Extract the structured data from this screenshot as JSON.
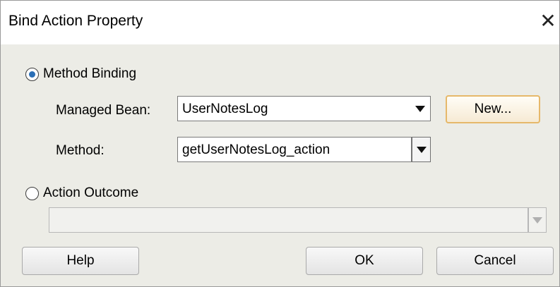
{
  "window": {
    "title": "Bind Action Property"
  },
  "method_binding": {
    "radio_label": "Method Binding",
    "checked": true,
    "managed_bean": {
      "label": "Managed Bean:",
      "value": "UserNotesLog"
    },
    "new_button": "New...",
    "method": {
      "label": "Method:",
      "value": "getUserNotesLog_action"
    }
  },
  "action_outcome": {
    "radio_label": "Action Outcome",
    "checked": false,
    "value": ""
  },
  "buttons": {
    "help": "Help",
    "ok": "OK",
    "cancel": "Cancel"
  },
  "icons": {
    "close": "close-icon",
    "dropdown": "chevron-down-icon"
  }
}
